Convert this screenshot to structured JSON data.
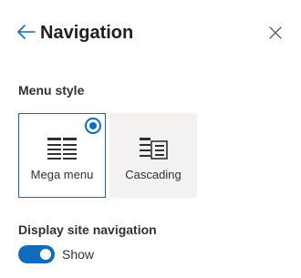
{
  "header": {
    "title": "Navigation",
    "back_icon": "arrow-left-icon",
    "close_icon": "close-icon"
  },
  "menu_style": {
    "label": "Menu style",
    "options": [
      {
        "label": "Mega menu",
        "icon": "mega-menu-icon",
        "selected": true
      },
      {
        "label": "Cascading",
        "icon": "cascading-menu-icon",
        "selected": false
      }
    ]
  },
  "display_site_navigation": {
    "label": "Display site navigation",
    "toggle_text": "Show",
    "on": true
  },
  "colors": {
    "accent": "#0f6cbd",
    "card_bg": "#f3f2f1",
    "text": "#323130"
  }
}
